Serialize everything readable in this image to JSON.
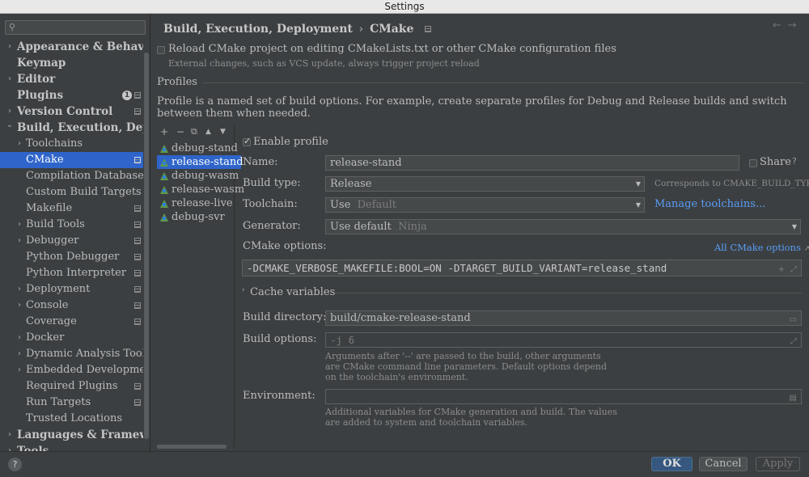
{
  "window": {
    "title": "Settings"
  },
  "sidebar": {
    "search_placeholder": "",
    "items": [
      {
        "label": "Appearance & Behavior",
        "level": 0,
        "expandable": true,
        "expanded": false
      },
      {
        "label": "Keymap",
        "level": 0,
        "expandable": false
      },
      {
        "label": "Editor",
        "level": 0,
        "expandable": true,
        "expanded": false
      },
      {
        "label": "Plugins",
        "level": 0,
        "expandable": false,
        "badge": "1"
      },
      {
        "label": "Version Control",
        "level": 0,
        "expandable": true,
        "expanded": false
      },
      {
        "label": "Build, Execution, Deployment",
        "level": 0,
        "expandable": true,
        "expanded": true
      },
      {
        "label": "Toolchains",
        "level": 1,
        "expandable": true
      },
      {
        "label": "CMake",
        "level": 1,
        "selected": true
      },
      {
        "label": "Compilation Database",
        "level": 1
      },
      {
        "label": "Custom Build Targets",
        "level": 1
      },
      {
        "label": "Makefile",
        "level": 1
      },
      {
        "label": "Build Tools",
        "level": 1,
        "expandable": true
      },
      {
        "label": "Debugger",
        "level": 1,
        "expandable": true
      },
      {
        "label": "Python Debugger",
        "level": 1
      },
      {
        "label": "Python Interpreter",
        "level": 1
      },
      {
        "label": "Deployment",
        "level": 1,
        "expandable": true
      },
      {
        "label": "Console",
        "level": 1,
        "expandable": true
      },
      {
        "label": "Coverage",
        "level": 1
      },
      {
        "label": "Docker",
        "level": 1,
        "expandable": true
      },
      {
        "label": "Dynamic Analysis Tools",
        "level": 1,
        "expandable": true
      },
      {
        "label": "Embedded Development",
        "level": 1,
        "expandable": true
      },
      {
        "label": "Required Plugins",
        "level": 1
      },
      {
        "label": "Run Targets",
        "level": 1
      },
      {
        "label": "Trusted Locations",
        "level": 1
      },
      {
        "label": "Languages & Frameworks",
        "level": 0,
        "expandable": true,
        "expanded": false
      },
      {
        "label": "Tools",
        "level": 0,
        "expandable": true,
        "expanded": false
      }
    ]
  },
  "header": {
    "breadcrumb_parent": "Build, Execution, Deployment",
    "breadcrumb_separator": "›",
    "breadcrumb_current": "CMake",
    "back": "←",
    "forward": "→"
  },
  "reload": {
    "label": "Reload CMake project on editing CMakeLists.txt or other CMake configuration files",
    "hint": "External changes, such as VCS update, always trigger project reload",
    "checked": false
  },
  "profiles": {
    "section_title": "Profiles",
    "description": "Profile is a named set of build options. For example, create separate profiles for Debug and Release builds and switch between them when needed.",
    "toolbar": {
      "add": "+",
      "remove": "−",
      "copy": "⧉",
      "up": "▲",
      "down": "▼"
    },
    "items": [
      "debug-stand",
      "release-stand",
      "debug-wasm",
      "release-wasm",
      "release-live",
      "debug-svr"
    ],
    "selected_index": 1
  },
  "form": {
    "enable_profile_label": "Enable profile",
    "enable_profile_checked": true,
    "name_label": "Name:",
    "name_value": "release-stand",
    "share_label": "Share",
    "share_checked": false,
    "build_type_label": "Build type:",
    "build_type_value": "Release",
    "build_type_note": "Corresponds to CMAKE_BUILD_TYPE",
    "toolchain_label": "Toolchain:",
    "toolchain_value": "Use",
    "toolchain_placeholder": "Default",
    "manage_toolchains_link": "Manage toolchains...",
    "generator_label": "Generator:",
    "generator_value": "Use default",
    "generator_placeholder": "Ninja",
    "cmake_options_label": "CMake options:",
    "all_cmake_options_link": "All CMake options",
    "cmake_options_value": "-DCMAKE_VERBOSE_MAKEFILE:BOOL=ON -DTARGET_BUILD_VARIANT=release_stand",
    "cache_variables_label": "Cache variables",
    "build_directory_label": "Build directory:",
    "build_directory_value": "build/cmake-release-stand",
    "build_options_label": "Build options:",
    "build_options_placeholder": "-j 6",
    "build_options_hint": "Arguments after '--' are passed to the build, other arguments are CMake command line parameters. Default options depend on the toolchain's environment.",
    "environment_label": "Environment:",
    "environment_value": "",
    "environment_hint": "Additional variables for CMake generation and build. The values are added to system and toolchain variables."
  },
  "footer": {
    "help": "?",
    "ok": "OK",
    "cancel": "Cancel",
    "apply": "Apply"
  }
}
